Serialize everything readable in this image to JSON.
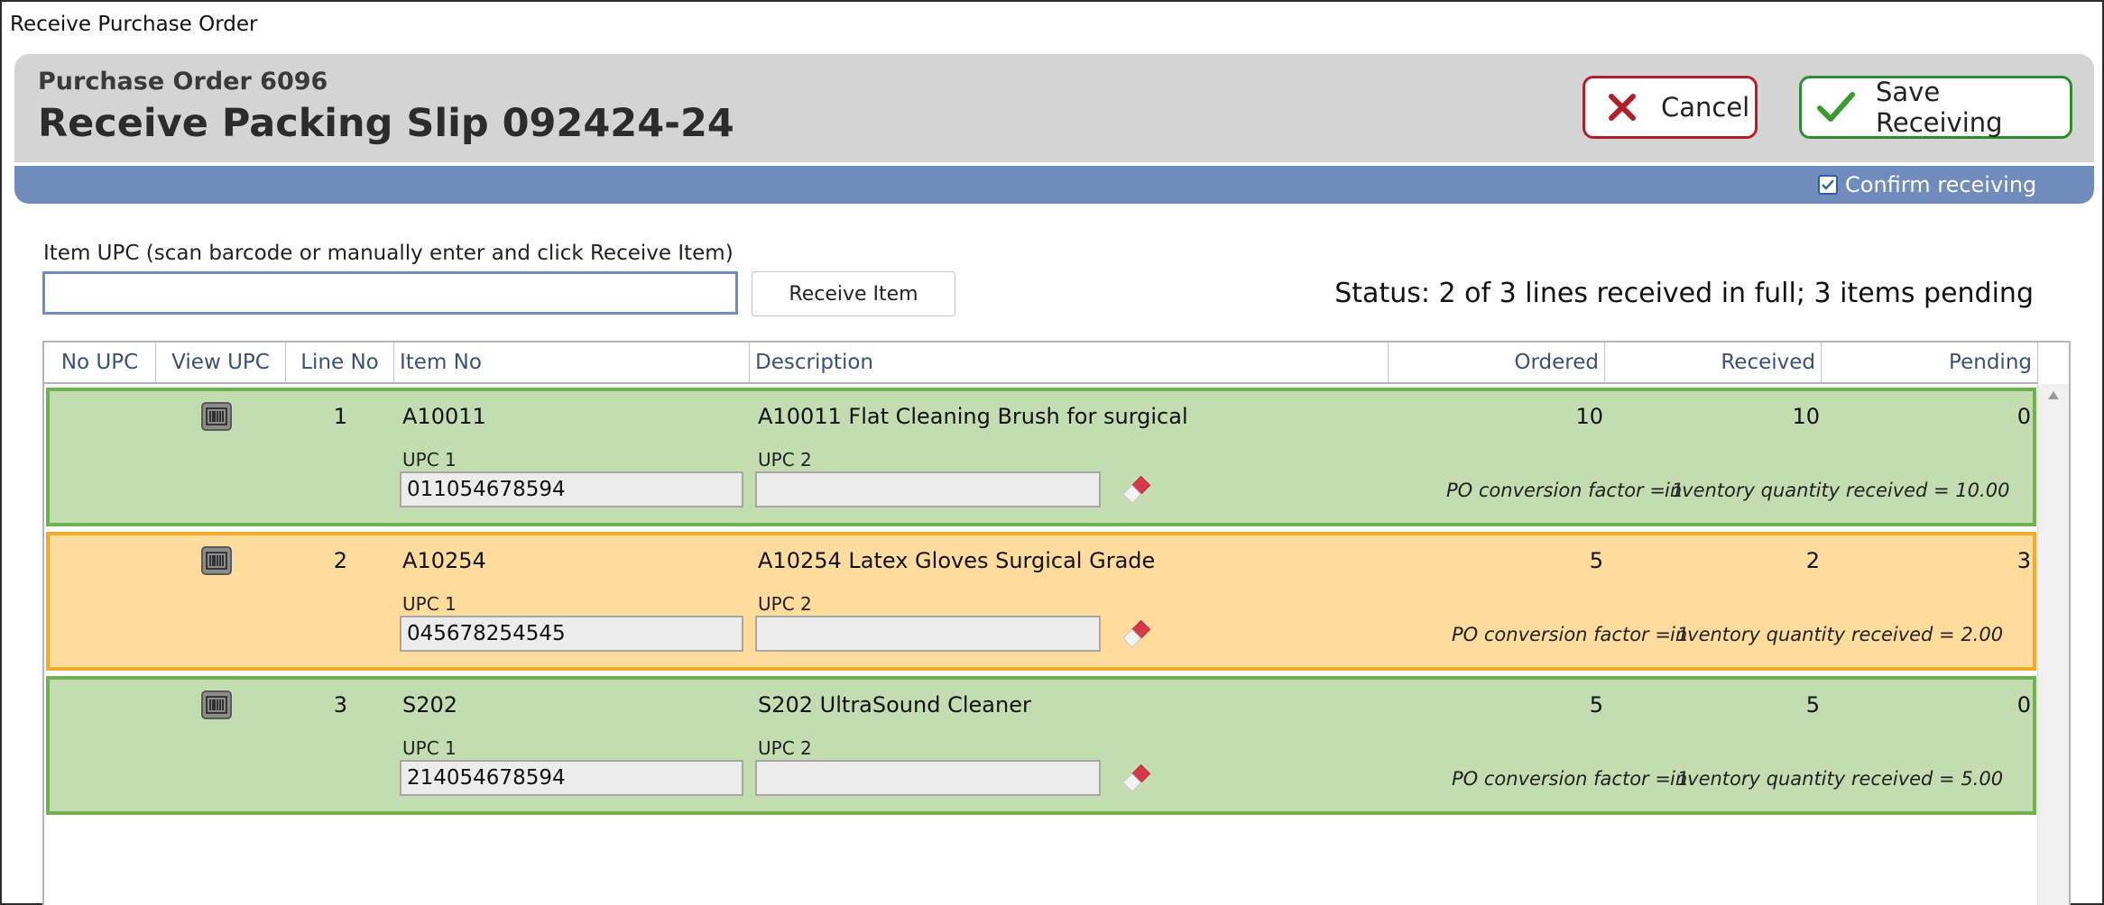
{
  "window": {
    "title": "Receive Purchase Order"
  },
  "header": {
    "po_number": "Purchase Order 6096",
    "title": "Receive Packing Slip 092424-24",
    "cancel_label": "Cancel",
    "save_label": "Save Receiving",
    "confirm_label": "Confirm receiving",
    "confirm_checked": true
  },
  "scan": {
    "label": "Item UPC (scan barcode or manually enter and click Receive Item)",
    "value": "",
    "button": "Receive Item"
  },
  "status": "Status: 2 of 3 lines received in full; 3 items pending",
  "table": {
    "columns": [
      "No UPC",
      "View UPC",
      "Line No",
      "Item No",
      "Description",
      "Ordered",
      "Received",
      "Pending"
    ],
    "upc1_label": "UPC 1",
    "upc2_label": "UPC 2",
    "rows": [
      {
        "line_no": "1",
        "item_no": "A10011",
        "description": "A10011 Flat Cleaning Brush for surgical",
        "ordered": "10",
        "received": "10",
        "pending": "0",
        "upc1": "011054678594",
        "upc2": "",
        "conversion": "PO conversion factor = 1",
        "inventory": "inventory quantity received = 10.00",
        "state": "full"
      },
      {
        "line_no": "2",
        "item_no": "A10254",
        "description": "A10254 Latex Gloves Surgical Grade",
        "ordered": "5",
        "received": "2",
        "pending": "3",
        "upc1": "045678254545",
        "upc2": "",
        "conversion": "PO conversion factor = 1",
        "inventory": "inventory quantity received = 2.00",
        "state": "partial"
      },
      {
        "line_no": "3",
        "item_no": "S202",
        "description": "S202 UltraSound Cleaner",
        "ordered": "5",
        "received": "5",
        "pending": "0",
        "upc1": "214054678594",
        "upc2": "",
        "conversion": "PO conversion factor = 1",
        "inventory": "inventory quantity received = 5.00",
        "state": "full"
      }
    ]
  },
  "colors": {
    "full_row": "#c3dcb0",
    "partial_row": "#ffdb9c",
    "cancel_border": "#b31e2b",
    "save_border": "#2e8b2e",
    "header_bar": "#6f8cbd"
  },
  "icons": {
    "cancel": "x-icon",
    "save": "checkmark-icon",
    "view_upc": "barcode-icon",
    "clear_upc": "eraser-icon"
  }
}
